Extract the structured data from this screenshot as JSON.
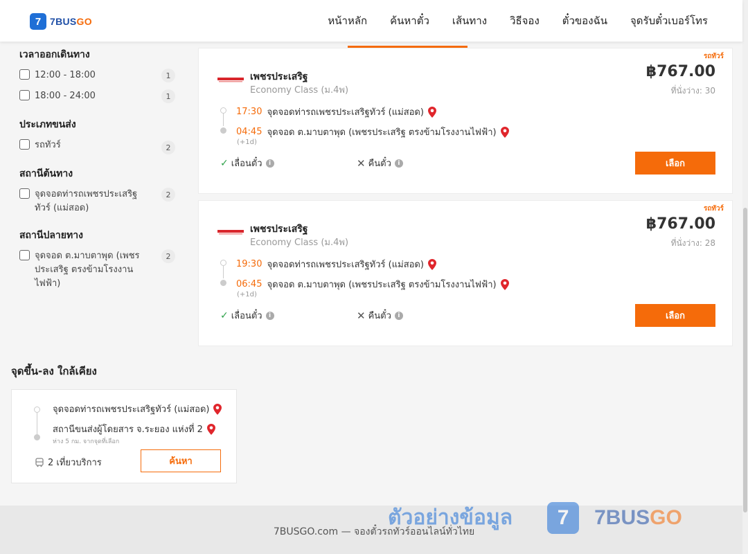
{
  "header": {
    "logo_text": "7BUS",
    "logo_text_go": "GO",
    "logo_mark": "7",
    "nav": [
      "หน้าหลัก",
      "ค้นหาตั๋ว",
      "เส้นทาง",
      "วิธีจอง",
      "ตั๋วของฉัน",
      "จุดรับตั๋วเบอร์โทร"
    ]
  },
  "filters": {
    "departure_time": {
      "title": "เวลาออกเดินทาง",
      "options": [
        {
          "label": "12:00 - 18:00",
          "count": "1"
        },
        {
          "label": "18:00 - 24:00",
          "count": "1"
        }
      ]
    },
    "vehicle_type": {
      "title": "ประเภทขนส่ง",
      "options": [
        {
          "label": "รถทัวร์",
          "count": "2"
        }
      ]
    },
    "origin_station": {
      "title": "สถานีต้นทาง",
      "options": [
        {
          "label": "จุดจอดท่ารถเพชรประเสริฐทัวร์ (แม่สอด)",
          "count": "2"
        }
      ]
    },
    "destination_station": {
      "title": "สถานีปลายทาง",
      "options": [
        {
          "label": "จุดจอด ต.มาบตาพุด (เพชรประเสริฐ ตรงข้ามโรงงานไฟฟ้า)",
          "count": "2"
        }
      ]
    }
  },
  "results": [
    {
      "tag": "รถทัวร์",
      "operator": "เพชรประเสริฐ",
      "class": "Economy Class (ม.4พ)",
      "price": "฿767.00",
      "seats": "ที่นั่งว่าง: 30",
      "depart_time": "17:30",
      "depart_stop": "จุดจอดท่ารถเพชรประเสริฐทัวร์ (แม่สอด)",
      "arrive_time": "04:45",
      "arrive_stop": "จุดจอด ต.มาบตาพุด (เพชรประเสริฐ ตรงข้ามโรงงานไฟฟ้า)",
      "day_offset": "(+1d)",
      "policy_change": "เลื่อนตั๋ว",
      "policy_refund": "คืนตั๋ว",
      "select_label": "เลือก"
    },
    {
      "tag": "รถทัวร์",
      "operator": "เพชรประเสริฐ",
      "class": "Economy Class (ม.4พ)",
      "price": "฿767.00",
      "seats": "ที่นั่งว่าง: 28",
      "depart_time": "19:30",
      "depart_stop": "จุดจอดท่ารถเพชรประเสริฐทัวร์ (แม่สอด)",
      "arrive_time": "06:45",
      "arrive_stop": "จุดจอด ต.มาบตาพุด (เพชรประเสริฐ ตรงข้ามโรงงานไฟฟ้า)",
      "day_offset": "(+1d)",
      "policy_change": "เลื่อนตั๋ว",
      "policy_refund": "คืนตั๋ว",
      "select_label": "เลือก"
    }
  ],
  "nearby": {
    "title": "จุดขึ้น-ลง ใกล้เคียง",
    "from": "จุดจอดท่ารถเพชรประเสริฐทัวร์ (แม่สอด)",
    "to": "สถานีขนส่งผู้โดยสาร จ.ระยอง แห่งที่ 2",
    "distance_note": "ห่าง 5 กม. จากจุดที่เลือก",
    "trips": "2 เที่ยวบริการ",
    "search_label": "ค้นหา"
  },
  "footer": {
    "text": "7BUSGO.com — จองตั๋วรถทัวร์ออนไลน์ทั่วไทย"
  },
  "watermark": {
    "text": "ตัวอย่างข้อมูล",
    "mark": "7",
    "brand": "7BUS",
    "brand_go": "GO"
  },
  "colors": {
    "accent": "#f56b0a",
    "brand_blue": "#1f6fd6",
    "check_green": "#2ea14a"
  }
}
